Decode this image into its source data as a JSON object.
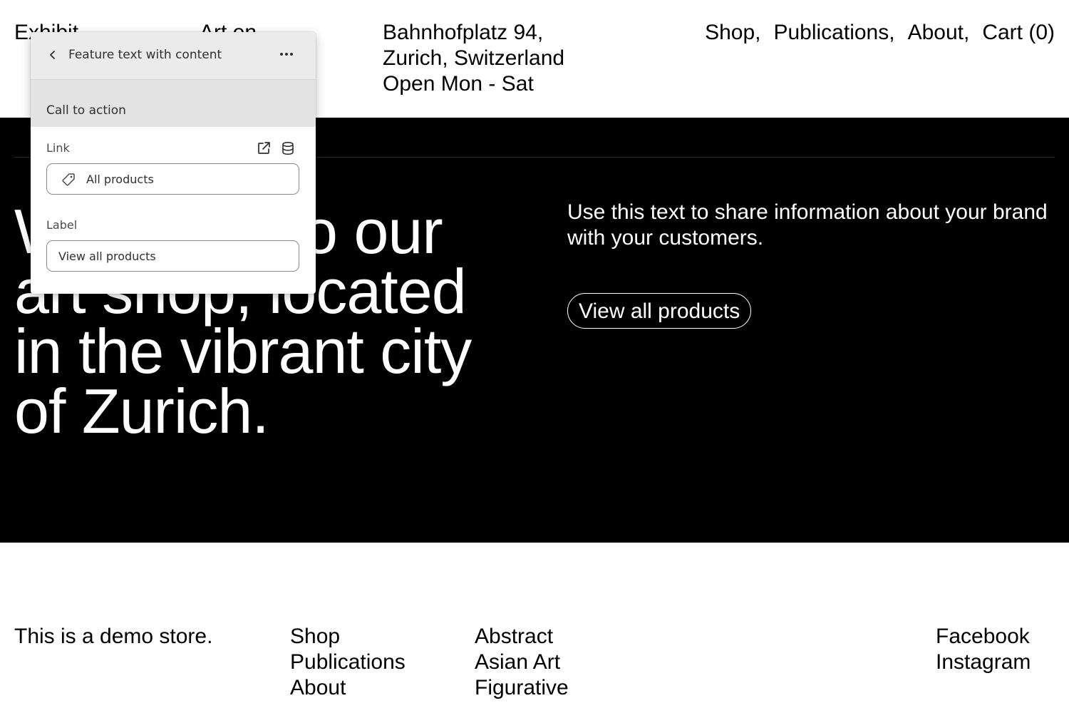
{
  "header": {
    "brand_part1": "Exhibit",
    "brand_part2": "Art on",
    "address": [
      "Bahnhofplatz 94,",
      "Zurich, Switzerland",
      "Open Mon - Sat"
    ],
    "nav": [
      "Shop,",
      "Publications,",
      "About,",
      "Cart (0)"
    ]
  },
  "hero": {
    "heading": "Welcome to our art shop, located in the vibrant city of Zurich.",
    "text": "Use this text to share information about your brand with your customers.",
    "cta_label": "View all products"
  },
  "footer": {
    "tagline": "This is a demo store.",
    "menu": [
      "Shop",
      "Publications",
      "About"
    ],
    "categories": [
      "Abstract",
      "Asian Art",
      "Figurative"
    ],
    "social": [
      "Facebook",
      "Instagram"
    ]
  },
  "editor_panel": {
    "title": "Feature text with content",
    "section_title": "Call to action",
    "link_label": "Link",
    "link_value": "All products",
    "label_label": "Label",
    "label_value": "View all products",
    "icons": [
      "chevron-left-icon",
      "more-horizontal-icon",
      "external-link-icon",
      "database-icon",
      "tag-icon"
    ]
  },
  "colors": {
    "hero_background": "#000000",
    "hero_text": "#ffffff",
    "panel_header": "#ebebeb",
    "panel_section": "#e3e3e3"
  }
}
